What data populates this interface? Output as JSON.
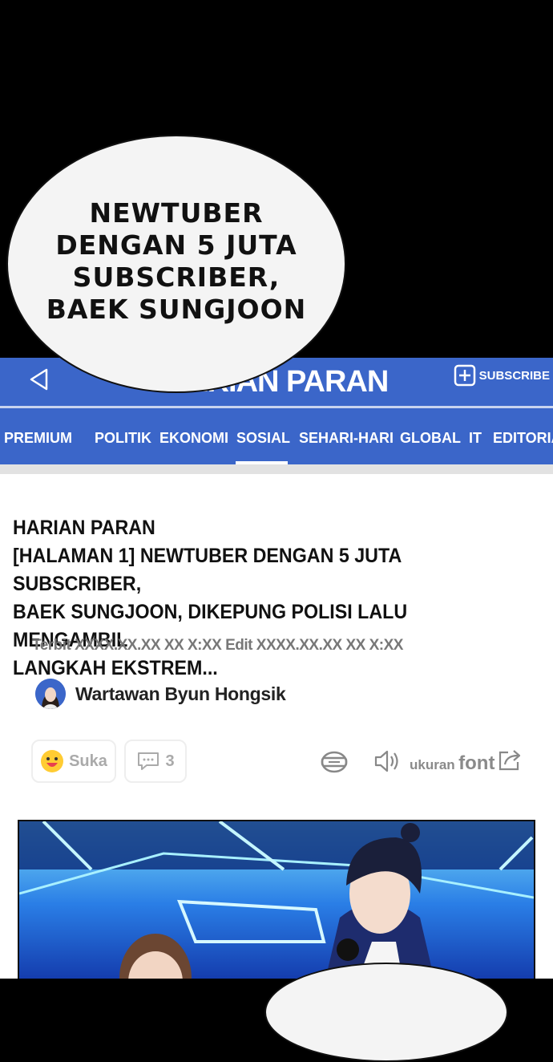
{
  "bubble": {
    "text": "NEWTUBER DENGAN 5 JUTA SUBSCRIBER, BAEK SUNGJOON"
  },
  "header": {
    "brand": "HARIAN PARAN",
    "subscribe_label": "SUBSCRIBE"
  },
  "nav": {
    "items": [
      "PREMIUM",
      "POLITIK",
      "EKONOMI",
      "SOSIAL",
      "SEHARI-HARI",
      "GLOBAL",
      "IT",
      "EDITORIA"
    ],
    "active": "SOSIAL"
  },
  "article": {
    "headline_lines": [
      "HARIAN PARAN",
      "[HALAMAN 1] NEWTUBER DENGAN 5 JUTA SUBSCRIBER,",
      "BAEK SUNGJOON, DIKEPUNG POLISI LALU MENGAMBIL",
      "LANGKAH EKSTREM..."
    ],
    "meta": "Terbit XXXX.XX.XX XX X:XX Edit XXXX.XX.XX XX X:XX",
    "author": "Wartawan Byun Hongsik"
  },
  "actions": {
    "like_label": "Suka",
    "comment_count": "3",
    "font_label_small": "ukuran",
    "font_label_big": "font"
  },
  "colors": {
    "brand_blue": "#3b66c9",
    "text_dark": "#111111",
    "muted": "#777777"
  },
  "icons": [
    "back-icon",
    "subscribe-plus-icon",
    "smiley-icon",
    "comment-icon",
    "reader-icon",
    "speaker-icon",
    "share-icon"
  ]
}
